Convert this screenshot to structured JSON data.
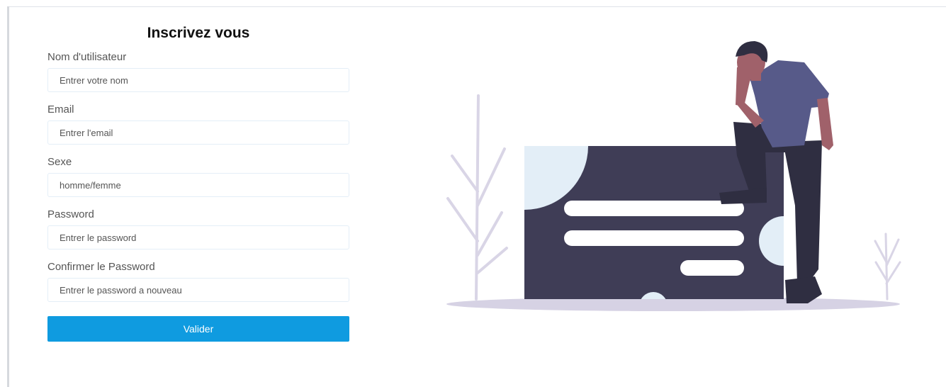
{
  "form": {
    "title": "Inscrivez vous",
    "fields": [
      {
        "label": "Nom d'utilisateur",
        "placeholder": "Entrer votre nom",
        "value": ""
      },
      {
        "label": "Email",
        "placeholder": "Entrer l'email",
        "value": ""
      },
      {
        "label": "Sexe",
        "placeholder": "homme/femme",
        "value": ""
      },
      {
        "label": "Password",
        "placeholder": "Entrer le password",
        "value": ""
      },
      {
        "label": "Confirmer le Password",
        "placeholder": "Entrer le password a nouveau",
        "value": ""
      }
    ],
    "submit_label": "Valider"
  },
  "colors": {
    "accent": "#0f9be0",
    "input_border": "#e4eef7",
    "card": "#3f3d56",
    "shirt": "#575a89",
    "skin": "#a0616a",
    "pants": "#2f2e41"
  },
  "illustration": {
    "icon": "person-leaning-on-form-illustration"
  }
}
